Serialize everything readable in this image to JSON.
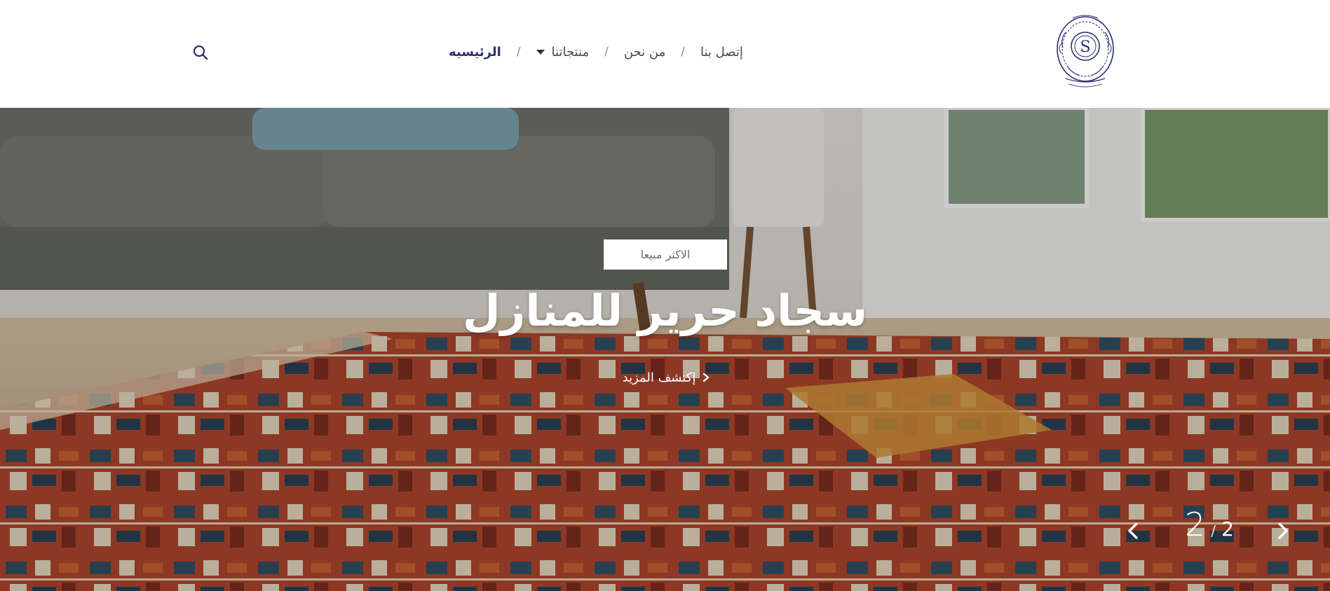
{
  "header": {
    "logo_icon": "ornamental-s-crest-logo",
    "logo_color": "#2c2f6e",
    "search_icon": "search-icon"
  },
  "nav": {
    "items": [
      {
        "label": "الرئيسيه",
        "active": true
      },
      {
        "label": "منتجاتنا",
        "has_dropdown": true
      },
      {
        "label": "من نحن"
      },
      {
        "label": "إتصل بنا"
      }
    ],
    "separator": "/"
  },
  "hero": {
    "badge": "الاكثر مبيعا",
    "title": "سجاد حرير للمنازل",
    "link_label": "إكتشف المزيد",
    "slide_current": "2",
    "slide_separator": "/",
    "slide_total": "2",
    "prev_icon": "chevron-left-icon",
    "next_icon": "chevron-right-icon"
  },
  "colors": {
    "brand": "#2c2f6e",
    "nav_text": "#4a4a55",
    "hero_text": "#ffffff"
  }
}
